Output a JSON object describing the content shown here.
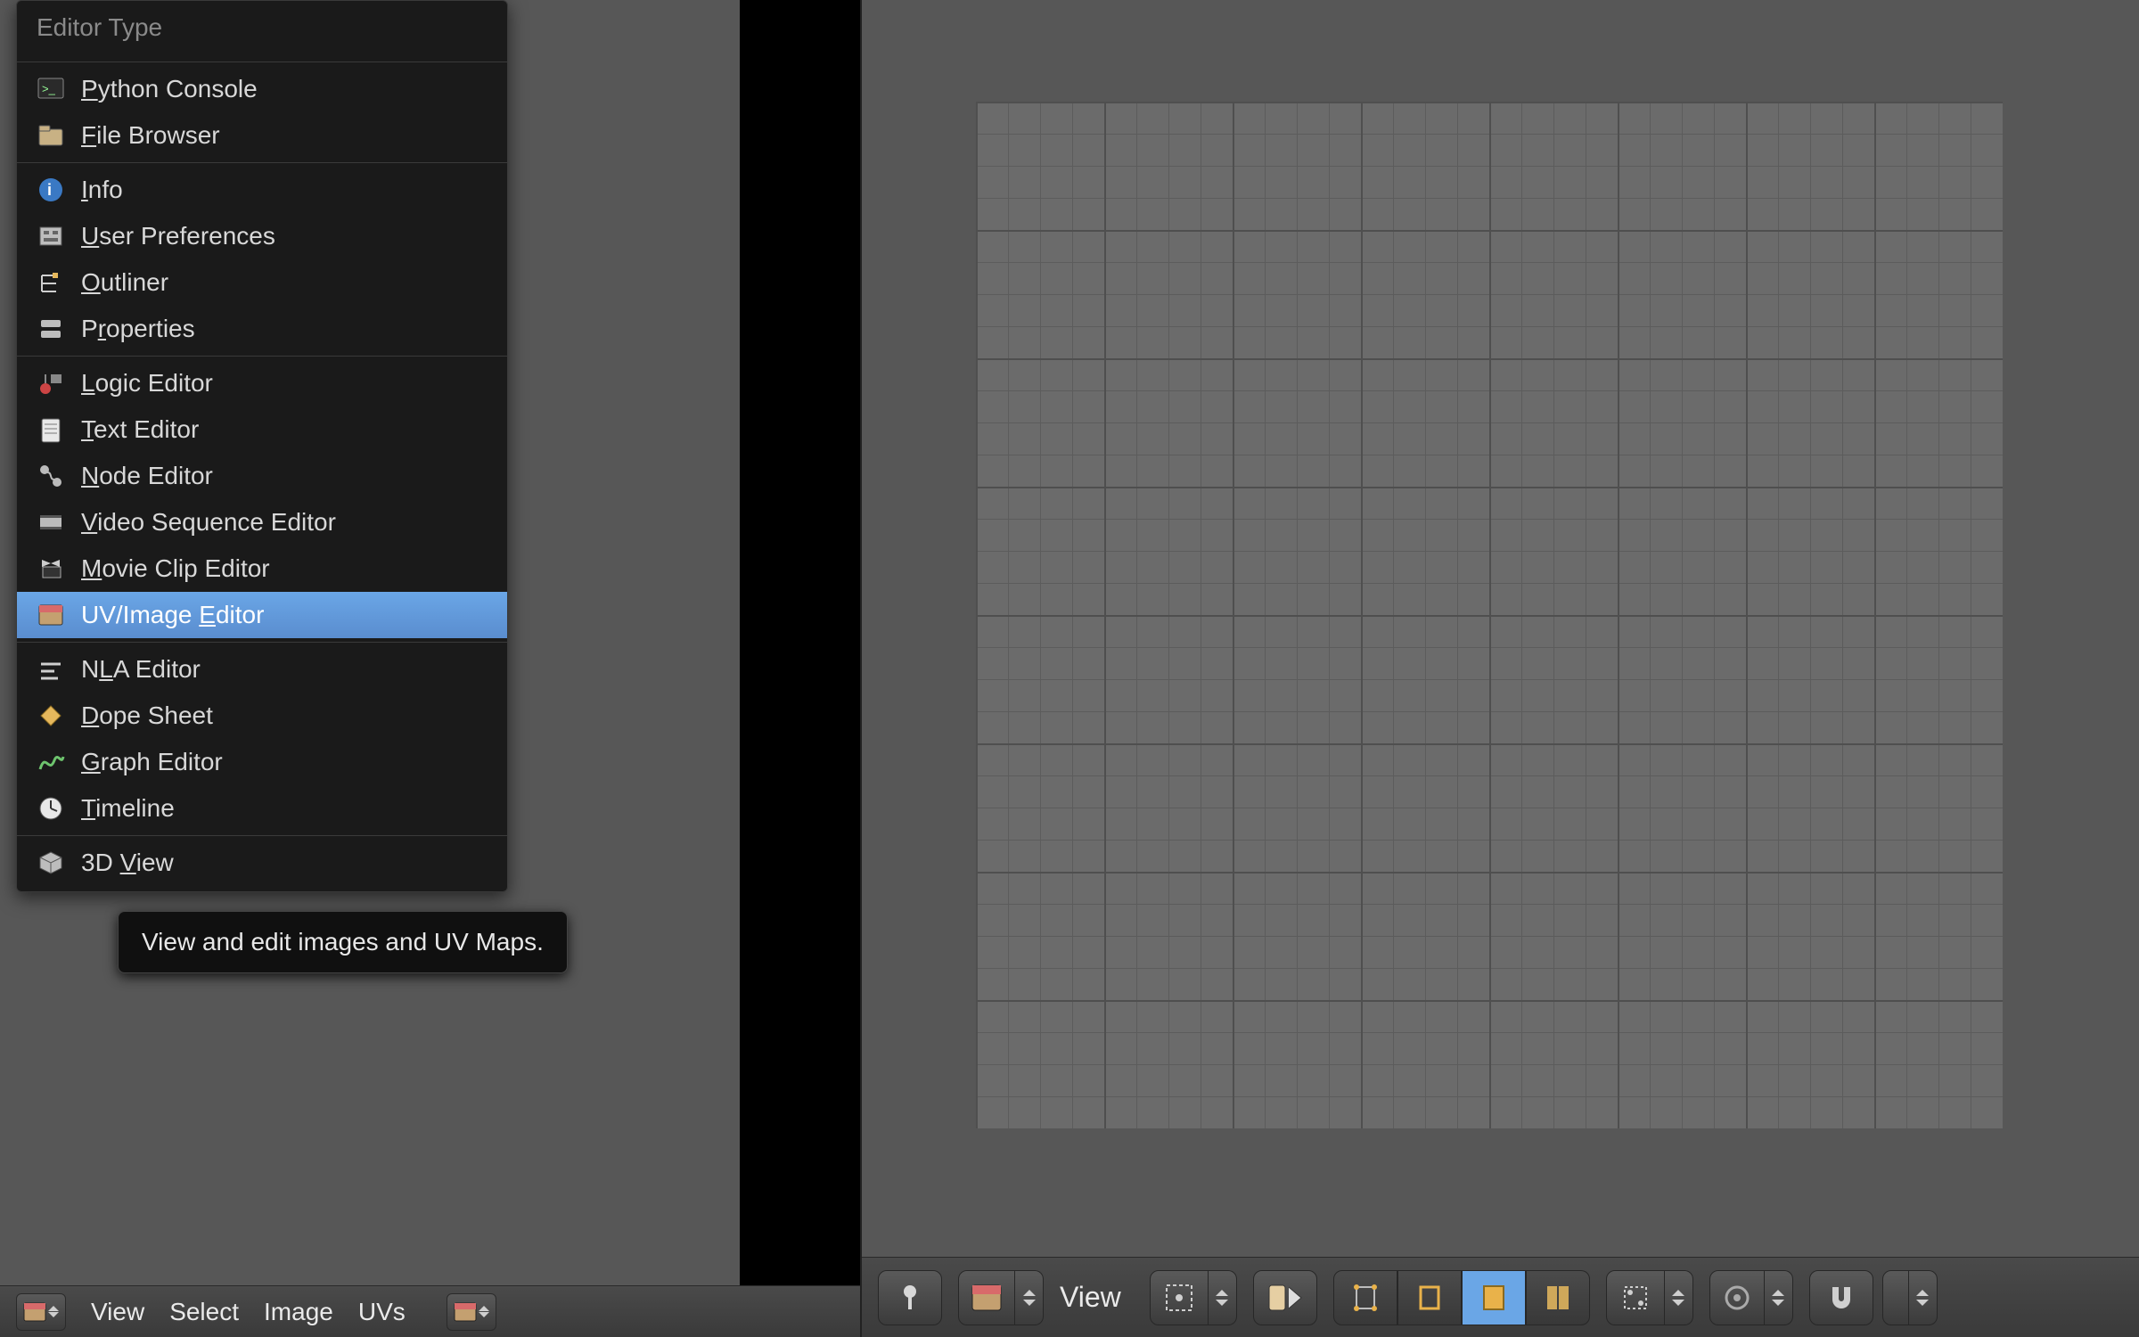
{
  "editor_menu": {
    "title": "Editor Type",
    "groups": [
      [
        {
          "id": "python-console",
          "label": "Python Console",
          "underline": "P",
          "tail": "ython Console",
          "icon": "console"
        },
        {
          "id": "file-browser",
          "label": "File Browser",
          "underline": "F",
          "tail": "ile Browser",
          "icon": "filebrowser"
        }
      ],
      [
        {
          "id": "info",
          "label": "Info",
          "underline": "I",
          "tail": "nfo",
          "icon": "info"
        },
        {
          "id": "user-preferences",
          "label": "User Preferences",
          "underline": "U",
          "tail": "ser Preferences",
          "icon": "prefs"
        },
        {
          "id": "outliner",
          "label": "Outliner",
          "underline": "O",
          "tail": "utliner",
          "icon": "outliner"
        },
        {
          "id": "properties",
          "label": "Properties",
          "underline": "r",
          "pre": "P",
          "tail": "operties",
          "icon": "properties"
        }
      ],
      [
        {
          "id": "logic-editor",
          "label": "Logic Editor",
          "underline": "L",
          "tail": "ogic Editor",
          "icon": "logic"
        },
        {
          "id": "text-editor",
          "label": "Text Editor",
          "underline": "T",
          "tail": "ext Editor",
          "icon": "text"
        },
        {
          "id": "node-editor",
          "label": "Node Editor",
          "underline": "N",
          "tail": "ode Editor",
          "icon": "node"
        },
        {
          "id": "video-sequence-editor",
          "label": "Video Sequence Editor",
          "underline": "V",
          "tail": "ideo Sequence Editor",
          "icon": "vse"
        },
        {
          "id": "movie-clip-editor",
          "label": "Movie Clip Editor",
          "underline": "M",
          "pre": "",
          "tail": "ovie Clip Editor",
          "icon": "clip"
        },
        {
          "id": "uv-image-editor",
          "label": "UV/Image Editor",
          "underline": "E",
          "pre": "UV/Image ",
          "tail": "ditor",
          "icon": "image",
          "highlighted": true
        }
      ],
      [
        {
          "id": "nla-editor",
          "label": "NLA Editor",
          "underline": "L",
          "pre": "N",
          "tail": "A Editor",
          "icon": "nla"
        },
        {
          "id": "dope-sheet",
          "label": "Dope Sheet",
          "underline": "D",
          "tail": "ope Sheet",
          "icon": "dope"
        },
        {
          "id": "graph-editor",
          "label": "Graph Editor",
          "underline": "G",
          "tail": "raph Editor",
          "icon": "graph"
        },
        {
          "id": "timeline",
          "label": "Timeline",
          "underline": "T",
          "tail": "imeline",
          "icon": "timeline"
        }
      ],
      [
        {
          "id": "3d-view",
          "label": "3D View",
          "underline": "V",
          "pre": "3D ",
          "tail": "iew",
          "icon": "3dview"
        }
      ]
    ],
    "tooltip": "View and edit images and UV Maps."
  },
  "left_header": {
    "menus": [
      "View",
      "Select",
      "Image",
      "UVs"
    ]
  },
  "right_header": {
    "view_label": "View"
  }
}
